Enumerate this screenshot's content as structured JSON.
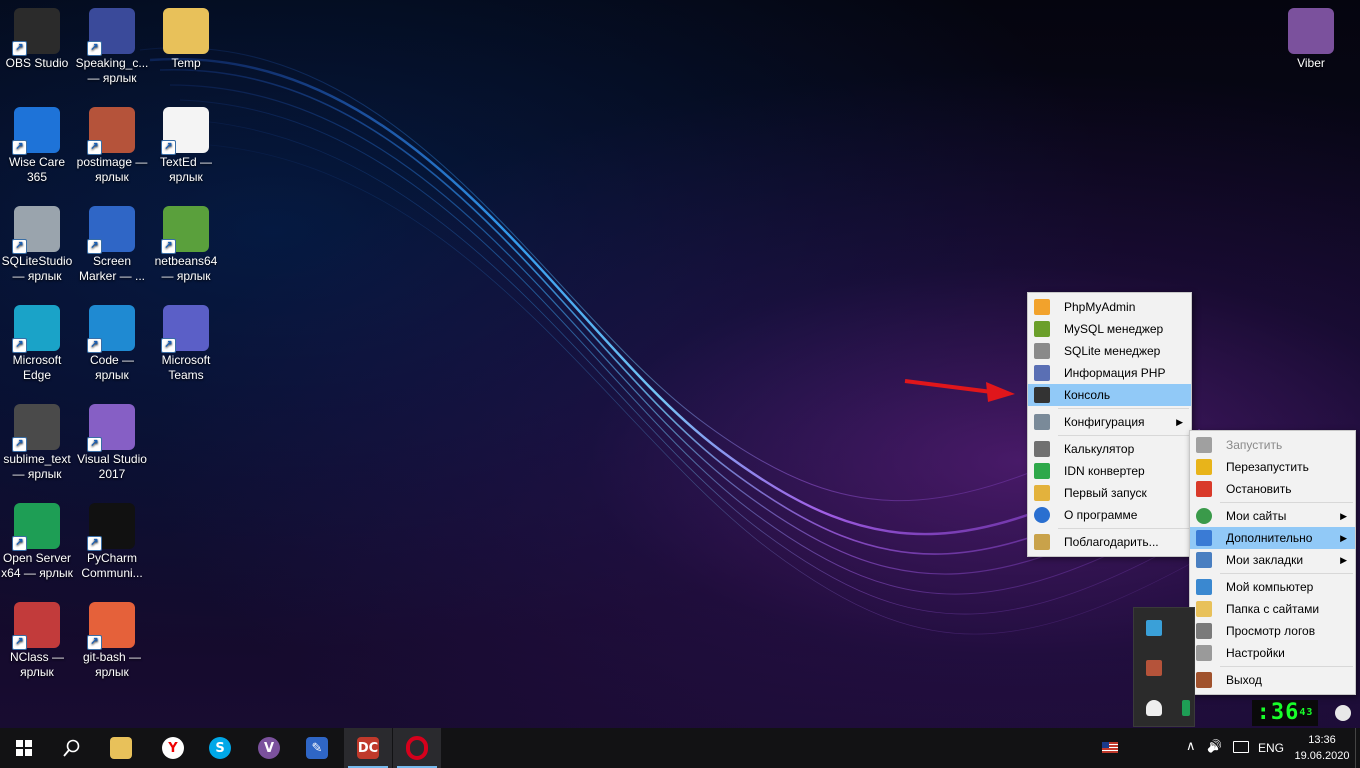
{
  "desktop": {
    "icons": [
      {
        "label": "OBS Studio",
        "icon": "obs-studio-icon",
        "color": "#2b2b2b"
      },
      {
        "label": "Speaking_c... — ярлык",
        "icon": "clock-icon",
        "color": "#3a4a9a"
      },
      {
        "label": "Temp",
        "icon": "folder-icon",
        "color": "#e8c15a"
      },
      {
        "label": "Wise Care 365",
        "icon": "wise-care-shield-icon",
        "color": "#1e73d8"
      },
      {
        "label": "postimage — ярлык",
        "icon": "postimage-icon",
        "color": "#b5533a"
      },
      {
        "label": "TextEd — ярлык",
        "icon": "texted-icon",
        "color": "#f4f4f4"
      },
      {
        "label": "SQLiteStudio — ярлык",
        "icon": "database-icon",
        "color": "#9aa4ad"
      },
      {
        "label": "Screen Marker — ...",
        "icon": "screen-marker-icon",
        "color": "#2f66c6"
      },
      {
        "label": "netbeans64 — ярлык",
        "icon": "netbeans-icon",
        "color": "#5aa03c"
      },
      {
        "label": "Microsoft Edge",
        "icon": "edge-icon",
        "color": "#1aa3c8"
      },
      {
        "label": "Code — ярлык",
        "icon": "vscode-icon",
        "color": "#1f8ad2"
      },
      {
        "label": "Microsoft Teams",
        "icon": "teams-icon",
        "color": "#5b5fc7"
      },
      {
        "label": "sublime_text — ярлык",
        "icon": "sublime-icon",
        "color": "#4a4a4a"
      },
      {
        "label": "Visual Studio 2017",
        "icon": "visual-studio-icon",
        "color": "#865fc5"
      },
      {
        "label": "Open Server x64 — ярлык",
        "icon": "open-server-icon",
        "color": "#1e9e55"
      },
      {
        "label": "PyCharm Communi...",
        "icon": "pycharm-icon",
        "color": "#111111"
      },
      {
        "label": "NClass — ярлык",
        "icon": "nclass-icon",
        "color": "#c23b3b"
      },
      {
        "label": "git-bash — ярлык",
        "icon": "git-bash-icon",
        "color": "#e5613a"
      },
      {
        "label": "Viber",
        "icon": "viber-icon",
        "color": "#7b519d"
      }
    ],
    "shortcut_arrow": "↗"
  },
  "menu_left": {
    "items": [
      {
        "label": "PhpMyAdmin",
        "icon": "phpmyadmin-icon"
      },
      {
        "label": "MySQL менеджер",
        "icon": "heidisql-icon"
      },
      {
        "label": "SQLite менеджер",
        "icon": "sqlite-manager-icon"
      },
      {
        "label": "Информация PHP",
        "icon": "php-info-icon"
      },
      {
        "label": "Консоль",
        "icon": "console-icon",
        "highlighted": true
      },
      {
        "label": "Конфигурация",
        "icon": "wrench-icon",
        "submenu": true
      },
      {
        "label": "Калькулятор",
        "icon": "calculator-icon"
      },
      {
        "label": "IDN конвертер",
        "icon": "idn-converter-icon"
      },
      {
        "label": "Первый запуск",
        "icon": "first-run-icon"
      },
      {
        "label": "О программе",
        "icon": "info-icon"
      },
      {
        "label": "Поблагодарить...",
        "icon": "thank-icon"
      }
    ]
  },
  "menu_right": {
    "items": [
      {
        "label": "Запустить",
        "icon": "gray-flag-icon",
        "disabled": true
      },
      {
        "label": "Перезапустить",
        "icon": "yellow-flag-icon"
      },
      {
        "label": "Остановить",
        "icon": "red-flag-icon"
      },
      {
        "label": "Мои сайты",
        "icon": "globe-icon",
        "submenu": true
      },
      {
        "label": "Дополнительно",
        "icon": "additional-icon",
        "submenu": true,
        "highlighted": true
      },
      {
        "label": "Мои закладки",
        "icon": "bookmarks-icon",
        "submenu": true
      },
      {
        "label": "Мой компьютер",
        "icon": "computer-icon"
      },
      {
        "label": "Папка с сайтами",
        "icon": "folder-icon"
      },
      {
        "label": "Просмотр логов",
        "icon": "logs-icon"
      },
      {
        "label": "Настройки",
        "icon": "settings-icon"
      },
      {
        "label": "Выход",
        "icon": "exit-door-icon"
      }
    ]
  },
  "taskbar": {
    "start_icon": "windows-start-icon",
    "search_icon": "search-icon",
    "apps": [
      {
        "icon": "file-explorer-icon",
        "glyph": "",
        "color": "#e8c15a"
      },
      {
        "icon": "yandex-browser-icon",
        "glyph": "Y",
        "color": "#ffffff"
      },
      {
        "icon": "skype-icon",
        "glyph": "S",
        "color": "#00a8e8"
      },
      {
        "icon": "viber-taskbar-icon",
        "glyph": "V",
        "color": "#7b519d"
      },
      {
        "icon": "screen-marker-taskbar-icon",
        "glyph": "✎",
        "color": "#2f66c6"
      },
      {
        "icon": "dc-taskbar-icon",
        "glyph": "DC",
        "color": "#c0392b",
        "active": true
      },
      {
        "icon": "opera-icon",
        "glyph": "O",
        "color": "#d6001c",
        "active": true
      }
    ],
    "tray": {
      "flag_icon": "us-flag-icon",
      "overflow_glyph": "∧",
      "volume_glyph": "🔊",
      "network_glyph": "▭",
      "language": "ENG",
      "time": "13:36",
      "date": "19.06.2020"
    }
  },
  "overlay": {
    "green_clock_text": ":36",
    "small_digits": "43"
  },
  "annotation": {
    "arrow_color": "#e0161b"
  }
}
